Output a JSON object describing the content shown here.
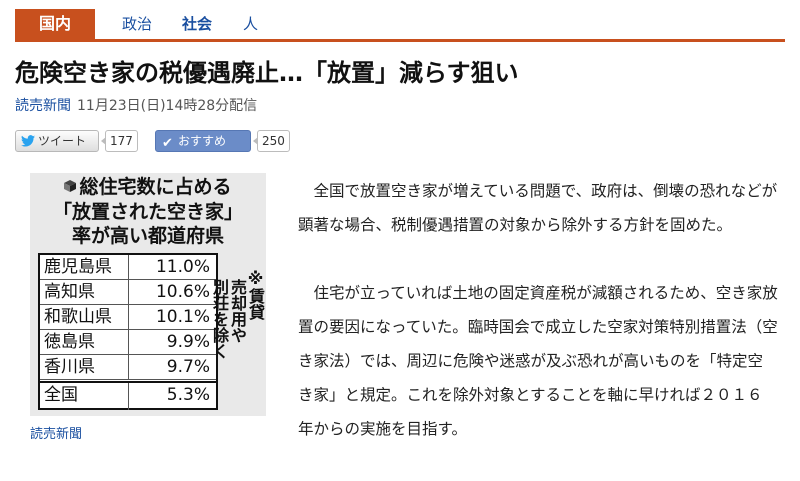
{
  "nav": {
    "items": [
      {
        "label": "国内"
      },
      {
        "label": "政治"
      },
      {
        "label": "社会"
      },
      {
        "label": "人"
      }
    ]
  },
  "article": {
    "headline": "危険空き家の税優遇廃止…「放置」減らす狙い",
    "source": "読売新聞",
    "datetime": "11月23日(日)14時28分配信",
    "paragraphs": [
      "全国で放置空き家が増えている問題で、政府は、倒壊の恐れなどが顕著な場合、税制優遇措置の対象から除外する方針を固めた。",
      "住宅が立っていれば土地の固定資産税が減額されるため、空き家放置の要因になっていた。臨時国会で成立した空家対策特別措置法（空き家法）では、周辺に危険や迷惑が及ぶ恐れが高いものを「特定空き家」と規定。これを除外対象とすることを軸に早ければ２０１６年からの実施を目指す。"
    ]
  },
  "social": {
    "tweet_label": "ツイート",
    "tweet_count": "177",
    "recommend_label": "おすすめ",
    "recommend_count": "250"
  },
  "figure": {
    "title_lines": [
      "総住宅数に占める",
      "「放置された空き家」",
      "率が高い都道府県"
    ],
    "rows": [
      {
        "pref": "鹿児島県",
        "value": "11.0%"
      },
      {
        "pref": "高知県",
        "value": "10.6%"
      },
      {
        "pref": "和歌山県",
        "value": "10.1%"
      },
      {
        "pref": "徳島県",
        "value": "9.9%"
      },
      {
        "pref": "香川県",
        "value": "9.7%"
      }
    ],
    "total": {
      "pref": "全国",
      "value": "5.3%"
    },
    "note_lines": [
      "※賃貸",
      "売却用や",
      "別荘を除く"
    ],
    "caption": "読売新聞"
  },
  "colors": {
    "accent": "#c8501e",
    "link": "#1a4fa0",
    "recommend": "#6b8cc8"
  }
}
